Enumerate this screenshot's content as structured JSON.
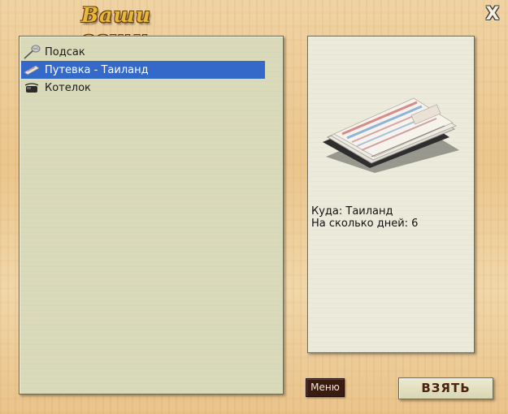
{
  "window": {
    "title": "Ваши вещи",
    "close_label": "X"
  },
  "items": [
    {
      "label": "Подсак",
      "icon": "net-icon",
      "selected": false
    },
    {
      "label": "Путевка - Таиланд",
      "icon": "ticket-icon",
      "selected": true
    },
    {
      "label": "Котелок",
      "icon": "pot-icon",
      "selected": false
    }
  ],
  "details": {
    "destination_label": "Куда: Таиланд",
    "days_label": "На сколько дней: 6",
    "image_icon": "travel-voucher-image"
  },
  "buttons": {
    "menu": "Меню",
    "take": "ВЗЯТЬ"
  },
  "colors": {
    "selection": "#3569c9",
    "panel": "#dcd9b9",
    "menu_button": "#3a1b12"
  }
}
